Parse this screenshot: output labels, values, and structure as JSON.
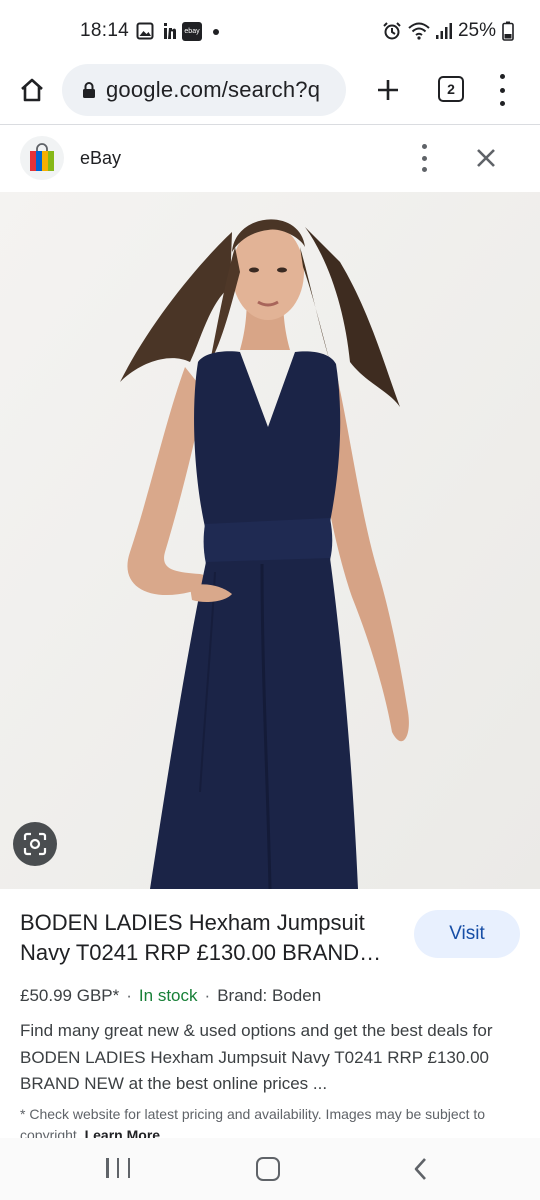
{
  "status_bar": {
    "time": "18:14",
    "notification_icons": [
      "gallery-icon",
      "linkedin-icon",
      "ebay-icon",
      "dot-icon"
    ],
    "ebay_badge_text": "ebay",
    "battery": "25%"
  },
  "browser": {
    "url": "google.com/search?q",
    "tab_count": "2"
  },
  "sheet": {
    "site_name": "eBay"
  },
  "product": {
    "title": "BODEN LADIES Hexham Jumpsuit Navy T0241 RRP £130.00 BRAND…",
    "visit_label": "Visit",
    "price": "£50.99 GBP*",
    "separator": "·",
    "stock": "In stock",
    "brand": "Brand: Boden",
    "description": "Find many great new & used options and get the best deals for BODEN LADIES Hexham Jumpsuit Navy T0241 RRP £130.00 BRAND NEW at the best online prices ...",
    "disclaimer": "* Check website for latest pricing and availability. Images may be subject to copyright.",
    "learn_more": "Learn More"
  },
  "colors": {
    "accent_link": "#174ea6",
    "visit_bg": "#e8f0fe",
    "in_stock": "#188038",
    "jumpsuit": "#1b2447"
  }
}
